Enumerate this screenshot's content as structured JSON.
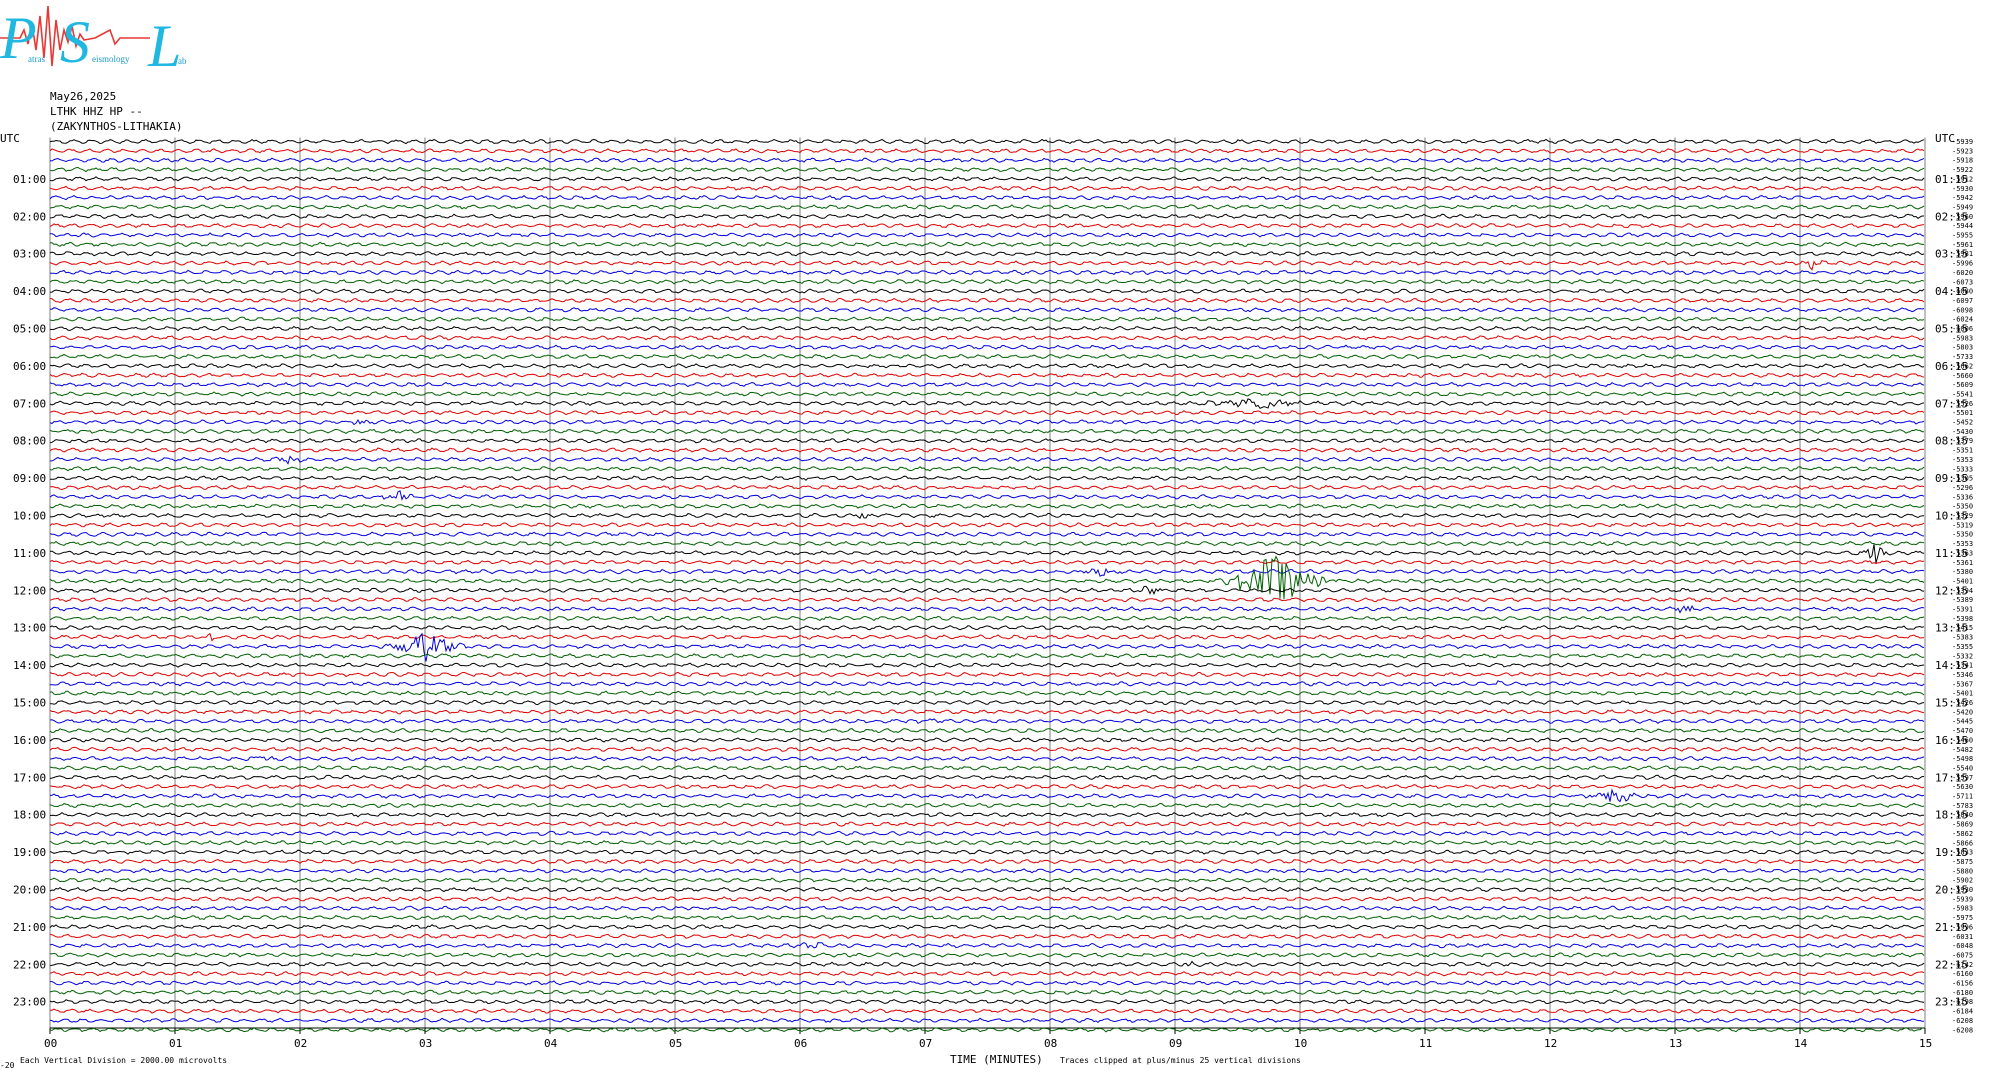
{
  "logo": {
    "big_letters": [
      "P",
      "S",
      "L"
    ],
    "small_text": [
      "atras",
      "eismology",
      "ab"
    ]
  },
  "header": {
    "date": "May26,2025",
    "station": "LTHK HHZ HP --",
    "location": "(ZAKYNTHOS-LITHAKIA)"
  },
  "footer": {
    "left_note": "Each Vertical Division = 2000.00 microvolts",
    "center_note": "Traces clipped at plus/minus 25 vertical divisions",
    "mini_mark": "-20"
  },
  "colors": {
    "trace_cycle": [
      "#000000",
      "#e00000",
      "#0000e0",
      "#006000"
    ],
    "grid": "#7f7f7f"
  },
  "chart_data": {
    "type": "line",
    "xlabel": "TIME (MINUTES)",
    "xlim": [
      0,
      15
    ],
    "x_ticks": [
      "00",
      "01",
      "02",
      "03",
      "04",
      "05",
      "06",
      "07",
      "08",
      "09",
      "10",
      "11",
      "12",
      "13",
      "14",
      "15"
    ],
    "left_axis_title": "UTC",
    "right_axis_title": "UTC",
    "left_hour_labels": [
      "01:00",
      "02:00",
      "03:00",
      "04:00",
      "05:00",
      "06:00",
      "07:00",
      "08:00",
      "09:00",
      "10:00",
      "11:00",
      "12:00",
      "13:00",
      "14:00",
      "15:00",
      "16:00",
      "17:00",
      "18:00",
      "19:00",
      "20:00",
      "21:00",
      "22:00",
      "23:00"
    ],
    "right_hour_labels": [
      "01:15",
      "02:15",
      "03:15",
      "04:15",
      "05:15",
      "06:15",
      "07:15",
      "08:15",
      "09:15",
      "10:15",
      "11:15",
      "12:15",
      "13:15",
      "14:15",
      "15:15",
      "16:15",
      "17:15",
      "18:15",
      "19:15",
      "20:15",
      "21:15",
      "22:15",
      "23:15"
    ],
    "trace_count": 96,
    "trace_values": [
      "-5939",
      "-5923",
      "-5918",
      "-5922",
      "-5912",
      "-5930",
      "-5942",
      "-5949",
      "-5960",
      "-5944",
      "-5955",
      "-5961",
      "-5981",
      "-5996",
      "-6020",
      "-6073",
      "-6080",
      "-6097",
      "-6098",
      "-6024",
      "-6006",
      "-5983",
      "-5803",
      "-5733",
      "-5662",
      "-5660",
      "-5609",
      "-5541",
      "-5526",
      "-5501",
      "-5452",
      "-5430",
      "-5379",
      "-5351",
      "-5353",
      "-5333",
      "-5305",
      "-5296",
      "-5336",
      "-5350",
      "-5329",
      "-5319",
      "-5350",
      "-5353",
      "-5363",
      "-5361",
      "-5380",
      "-5401",
      "-5394",
      "-5389",
      "-5391",
      "-5398",
      "-5415",
      "-5383",
      "-5355",
      "-5332",
      "-5341",
      "-5346",
      "-5367",
      "-5401",
      "-5426",
      "-5420",
      "-5445",
      "-5470",
      "-5460",
      "-5482",
      "-5498",
      "-5540",
      "-5597",
      "-5630",
      "-5711",
      "-5783",
      "-5840",
      "-5869",
      "-5862",
      "-5866",
      "-5833",
      "-5875",
      "-5880",
      "-5902",
      "-5930",
      "-5939",
      "-5983",
      "-5975",
      "-5996",
      "-6031",
      "-6048",
      "-6075",
      "-6142",
      "-6160",
      "-6156",
      "-6180",
      "-6198",
      "-6184",
      "-6208",
      "-6208"
    ],
    "events": [
      {
        "row": 54,
        "minute": 3.0,
        "amplitude": 22,
        "duration": 0.35
      },
      {
        "row": 47,
        "minute": 9.8,
        "amplitude": 40,
        "duration": 0.5,
        "spike": true
      },
      {
        "row": 44,
        "minute": 14.6,
        "amplitude": 12,
        "duration": 0.15
      },
      {
        "row": 70,
        "minute": 12.5,
        "amplitude": 8,
        "duration": 0.4
      },
      {
        "row": 28,
        "minute": 9.7,
        "amplitude": 6,
        "duration": 0.6
      },
      {
        "row": 13,
        "minute": 14.1,
        "amplitude": 6,
        "duration": 0.15
      },
      {
        "row": 30,
        "minute": 2.5,
        "amplitude": 6,
        "duration": 0.1
      },
      {
        "row": 34,
        "minute": 1.9,
        "amplitude": 5,
        "duration": 0.2
      },
      {
        "row": 38,
        "minute": 2.8,
        "amplitude": 6,
        "duration": 0.2
      },
      {
        "row": 40,
        "minute": 6.5,
        "amplitude": 5,
        "duration": 0.15
      },
      {
        "row": 86,
        "minute": 6.1,
        "amplitude": 5,
        "duration": 0.2
      },
      {
        "row": 88,
        "minute": 9.1,
        "amplitude": 4,
        "duration": 0.1
      },
      {
        "row": 46,
        "minute": 8.4,
        "amplitude": 5,
        "duration": 0.3
      },
      {
        "row": 48,
        "minute": 8.8,
        "amplitude": 4,
        "duration": 0.3
      },
      {
        "row": 53,
        "minute": 1.3,
        "amplitude": 4,
        "duration": 0.1
      },
      {
        "row": 58,
        "minute": 11.6,
        "amplitude": 4,
        "duration": 0.1
      },
      {
        "row": 66,
        "minute": 1.7,
        "amplitude": 4,
        "duration": 0.2
      },
      {
        "row": 50,
        "minute": 13.1,
        "amplitude": 4,
        "duration": 0.3
      },
      {
        "row": 62,
        "minute": 7.0,
        "amplitude": 3,
        "duration": 0.3
      }
    ]
  }
}
